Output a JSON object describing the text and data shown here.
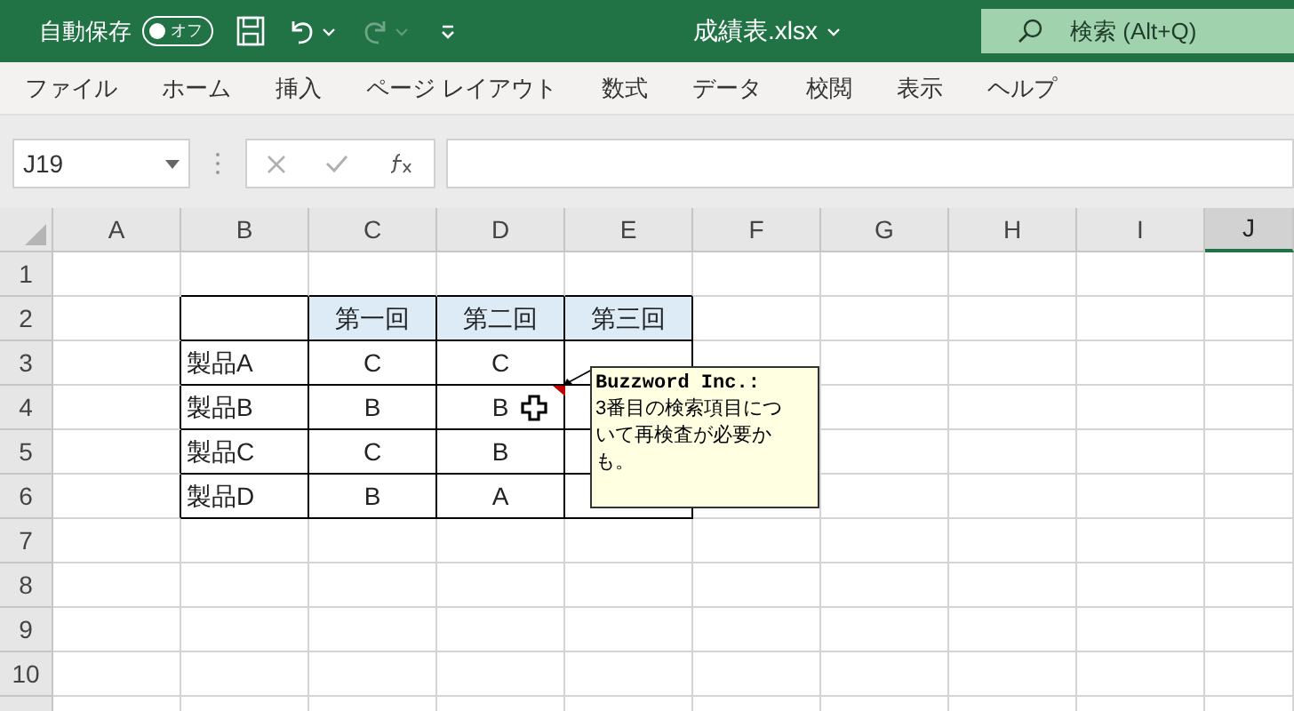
{
  "title_bar": {
    "autosave": {
      "label": "自動保存",
      "toggle_text": "オフ",
      "on": false
    },
    "redo_disabled": true,
    "filename": "成績表.xlsx",
    "search": {
      "placeholder": "検索 (Alt+Q)"
    }
  },
  "ribbon_tabs": [
    {
      "label": "ファイル"
    },
    {
      "label": "ホーム"
    },
    {
      "label": "挿入"
    },
    {
      "label": "ページ レイアウト"
    },
    {
      "label": "数式"
    },
    {
      "label": "データ"
    },
    {
      "label": "校閲"
    },
    {
      "label": "表示"
    },
    {
      "label": "ヘルプ"
    }
  ],
  "name_box": {
    "value": "J19"
  },
  "sheet": {
    "columns": [
      {
        "label": "A",
        "selected": false
      },
      {
        "label": "B",
        "selected": false
      },
      {
        "label": "C",
        "selected": false
      },
      {
        "label": "D",
        "selected": false
      },
      {
        "label": "E",
        "selected": false
      },
      {
        "label": "F",
        "selected": false
      },
      {
        "label": "G",
        "selected": false
      },
      {
        "label": "H",
        "selected": false
      },
      {
        "label": "I",
        "selected": false
      },
      {
        "label": "J",
        "selected": true
      }
    ],
    "rows": [
      "1",
      "2",
      "3",
      "4",
      "5",
      "6",
      "7",
      "8",
      "9",
      "10"
    ],
    "table": {
      "columns": [
        "第一回",
        "第二回",
        "第三回"
      ],
      "rows": [
        {
          "label": "製品A",
          "values": [
            "C",
            "C"
          ]
        },
        {
          "label": "製品B",
          "values": [
            "B",
            "B"
          ]
        },
        {
          "label": "製品C",
          "values": [
            "C",
            "B"
          ]
        },
        {
          "label": "製品D",
          "values": [
            "B",
            "A"
          ]
        }
      ]
    },
    "comment": {
      "author": "Buzzword Inc.:",
      "text": "3番目の検索項目について再検査が必要かも。"
    }
  }
}
